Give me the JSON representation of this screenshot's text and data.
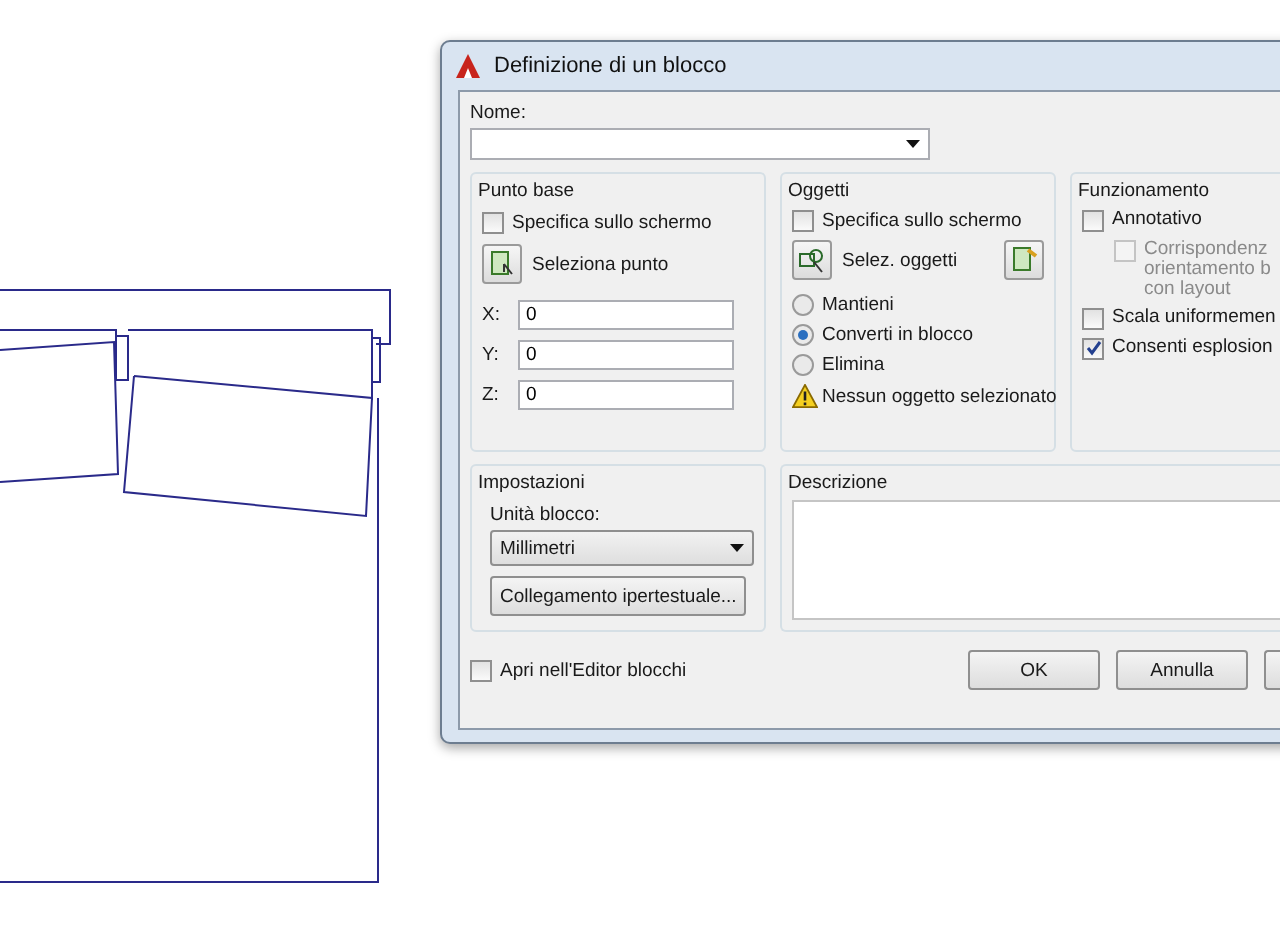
{
  "window": {
    "title": "Definizione di un blocco"
  },
  "name": {
    "label": "Nome:"
  },
  "base_point": {
    "title": "Punto base",
    "specify_on_screen": {
      "label": "Specifica sullo schermo",
      "checked": false
    },
    "pick_button": "Seleziona punto",
    "coords": [
      {
        "label": "X:",
        "value": "0"
      },
      {
        "label": "Y:",
        "value": "0"
      },
      {
        "label": "Z:",
        "value": "0"
      }
    ]
  },
  "objects": {
    "title": "Oggetti",
    "specify_on_screen": {
      "label": "Specifica sullo schermo",
      "checked": false
    },
    "select_button": "Selez. oggetti",
    "options": [
      {
        "label": "Mantieni",
        "selected": false
      },
      {
        "label": "Converti in blocco",
        "selected": true
      },
      {
        "label": "Elimina",
        "selected": false
      }
    ],
    "warning": "Nessun oggetto selezionato"
  },
  "behavior": {
    "title": "Funzionamento",
    "items": [
      {
        "lines": [
          "Annotativo"
        ],
        "checked": false,
        "disabled": false,
        "children": [
          {
            "lines": [
              "Corrispondenz",
              "orientamento b",
              "con layout"
            ],
            "checked": false,
            "disabled": true
          }
        ]
      },
      {
        "lines": [
          "Scala uniformemen"
        ],
        "checked": false,
        "disabled": false
      },
      {
        "lines": [
          "Consenti esplosion"
        ],
        "checked": true,
        "disabled": false
      }
    ]
  },
  "settings": {
    "title": "Impostazioni",
    "unit_label": "Unità blocco:",
    "unit_value": "Millimetri",
    "hyperlink_button": "Collegamento ipertestuale..."
  },
  "description": {
    "title": "Descrizione"
  },
  "open_in_editor": {
    "label": "Apri nell'Editor blocchi",
    "checked": false
  },
  "buttons": [
    "OK",
    "Annulla"
  ]
}
